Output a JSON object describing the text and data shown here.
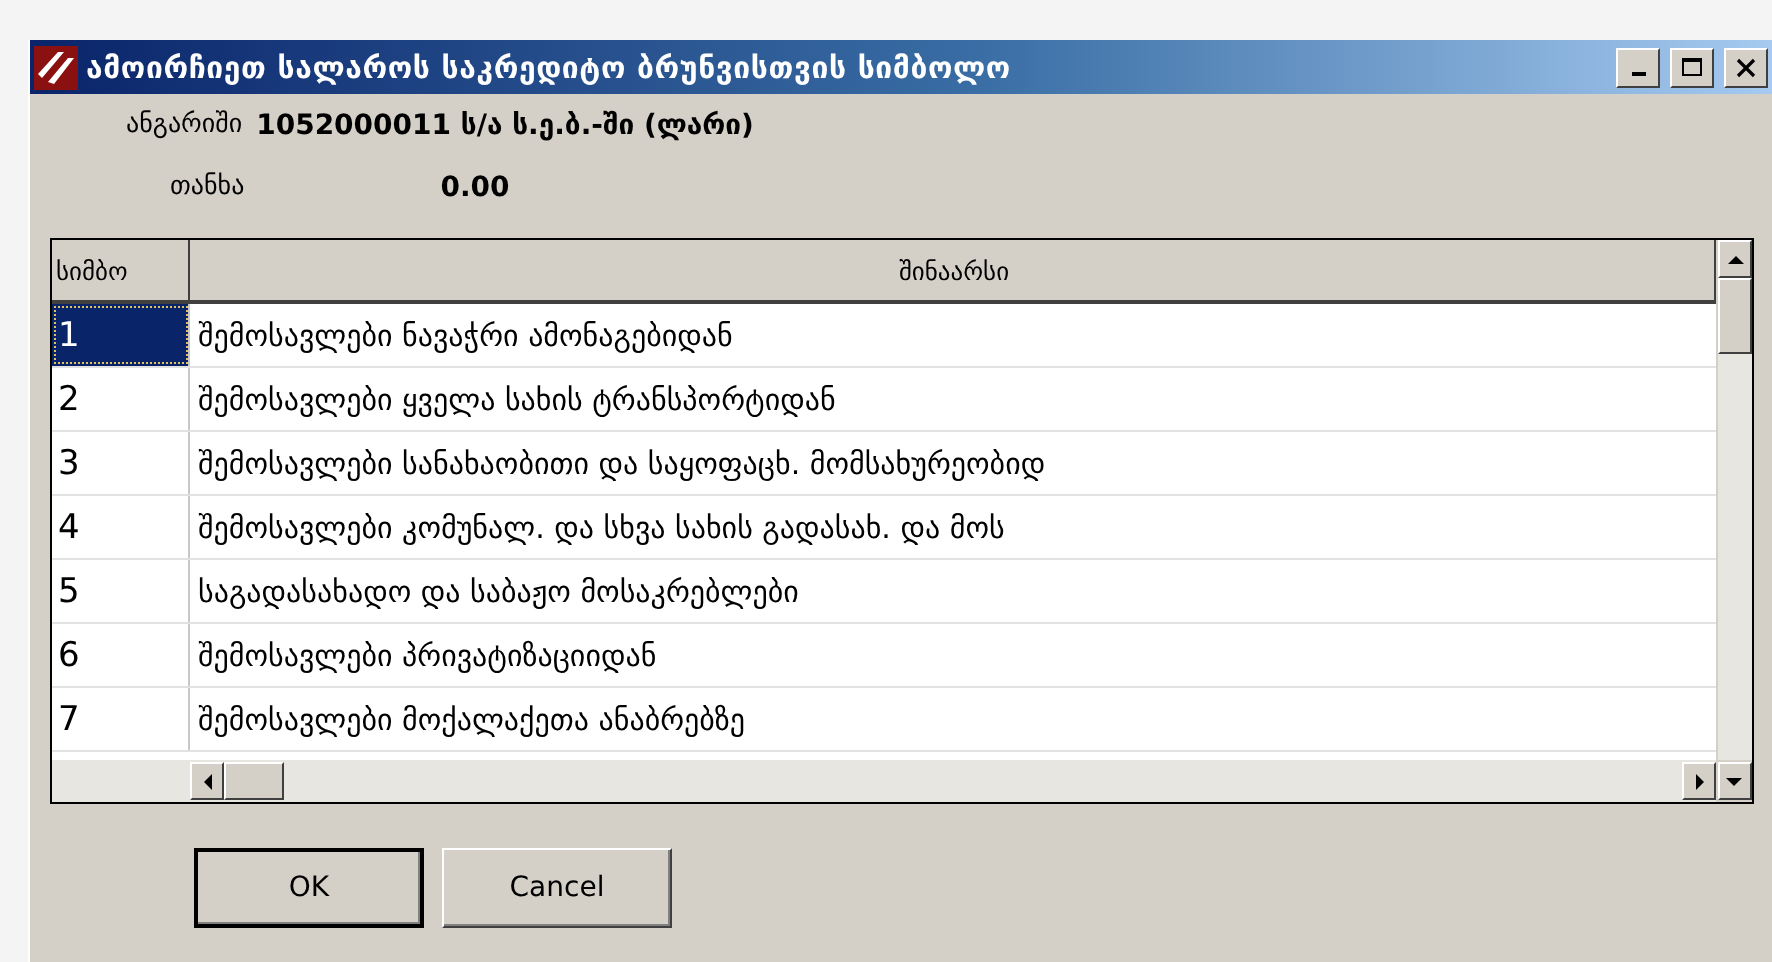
{
  "window": {
    "title": "ამოირჩიეთ სალაროს საკრედიტო ბრუნვისთვის სიმბოლო"
  },
  "account": {
    "label": "ანგარიში",
    "value": "1052000011 ს/ა ს.ე.ბ.-ში (ლარი)"
  },
  "amount": {
    "label": "თანხა",
    "value": "0.00"
  },
  "table": {
    "columns": [
      "სიმბო",
      "შინაარსი"
    ],
    "rows": [
      {
        "number": "1",
        "content": "შემოსავლები ნავაჭრი ამონაგებიდან",
        "selected": true
      },
      {
        "number": "2",
        "content": "შემოსავლები ყველა სახის ტრანსპორტიდან",
        "selected": false
      },
      {
        "number": "3",
        "content": "შემოსავლები სანახაობითი და საყოფაცხ. მომსახურეობიდ",
        "selected": false
      },
      {
        "number": "4",
        "content": "შემოსავლები კომუნალ. და სხვა სახის გადასახ. და მოს",
        "selected": false
      },
      {
        "number": "5",
        "content": "საგადასახადო და საბაჟო მოსაკრებლები",
        "selected": false
      },
      {
        "number": "6",
        "content": "შემოსავლები პრივატიზაციიდან",
        "selected": false
      },
      {
        "number": "7",
        "content": "შემოსავლები მოქალაქეთა ანაბრებზე",
        "selected": false
      }
    ]
  },
  "buttons": [
    {
      "label": "OK",
      "default": true
    },
    {
      "label": "Cancel",
      "default": false
    }
  ]
}
